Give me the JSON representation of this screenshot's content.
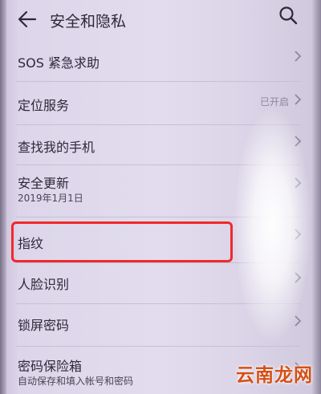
{
  "header": {
    "title": "安全和隐私"
  },
  "items": [
    {
      "label": "SOS 紧急求助"
    },
    {
      "label": "定位服务",
      "status": "已开启"
    },
    {
      "label": "查找我的手机"
    },
    {
      "label": "安全更新",
      "sub": "2019年1月1日"
    },
    {
      "label": "指纹"
    },
    {
      "label": "人脸识别"
    },
    {
      "label": "锁屏密码"
    },
    {
      "label": "密码保险箱",
      "sub": "自动保存和填入帐号和密码"
    }
  ],
  "watermark": "云南龙网",
  "icons": [
    "back-arrow-icon",
    "search-icon",
    "chevron-right-icon"
  ],
  "colors": {
    "highlight": "#ee2a2a",
    "background": "#ddd6ea",
    "watermark": "#d64f15"
  }
}
